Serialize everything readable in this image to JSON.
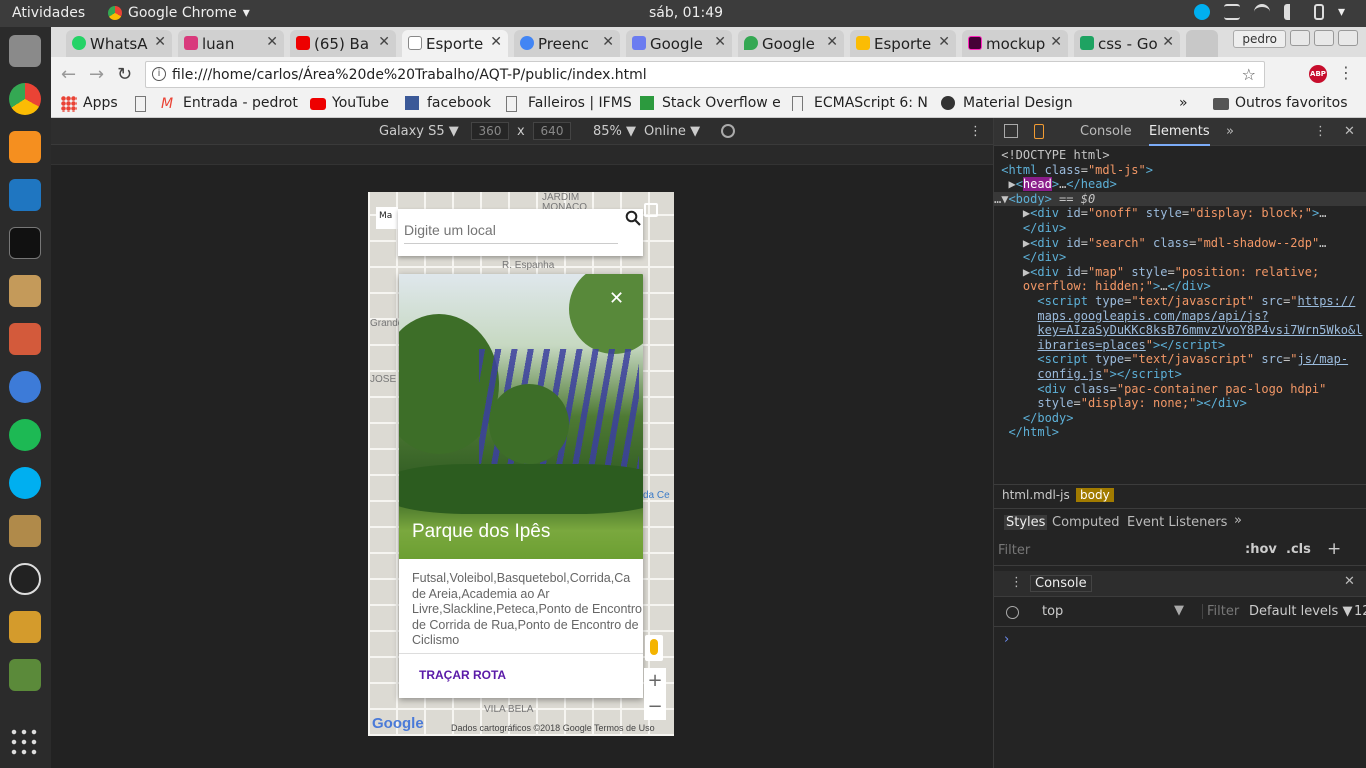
{
  "system": {
    "activities": "Atividades",
    "app_menu": "Google Chrome",
    "clock": "sáb, 01:49"
  },
  "tabs": [
    {
      "label": "WhatsA",
      "color": "#25d366"
    },
    {
      "label": "luan",
      "color": "#d93a7c"
    },
    {
      "label": "(65) Ba",
      "color": "#e00"
    },
    {
      "label": "Esporte",
      "color": "#999",
      "active": true
    },
    {
      "label": "Preenc",
      "color": "#4285f4"
    },
    {
      "label": "Google",
      "color": "#6b7cf0"
    },
    {
      "label": "Google",
      "color": "#34a853"
    },
    {
      "label": "Esporte",
      "color": "#fbbc04"
    },
    {
      "label": "mockup",
      "color": "#ff26be"
    },
    {
      "label": "css - Go",
      "color": "#1ea362"
    }
  ],
  "user_badge": "pedro",
  "address": {
    "url": "file:///home/carlos/Área%20de%20Trabalho/AQT-P/public/index.html",
    "abp": "ABP"
  },
  "bookmarks": [
    {
      "label": "Apps",
      "color": "#ea4335"
    },
    {
      "label": "",
      "color": "#bbb"
    },
    {
      "label": "Entrada - pedrot",
      "color": "#ea4335"
    },
    {
      "label": "YouTube",
      "color": "#e00"
    },
    {
      "label": "facebook",
      "color": "#3b5998"
    },
    {
      "label": "Falleiros | IFMS",
      "color": "#bbb"
    },
    {
      "label": "Stack Overflow e",
      "color": "#2c9a3e"
    },
    {
      "label": "ECMAScript 6: N",
      "color": "#bbb"
    },
    {
      "label": "Material Design",
      "color": "#333"
    },
    {
      "label": "»",
      "color": ""
    },
    {
      "label": "Outros favoritos",
      "color": "#555"
    }
  ],
  "device_toolbar": {
    "device": "Galaxy S5 ▼",
    "width": "360",
    "x": "x",
    "height": "640",
    "zoom": "85% ▼",
    "network": "Online ▼"
  },
  "map": {
    "search_placeholder": "Digite um local",
    "card_title": "Parque dos Ipês",
    "card_desc": "Futsal,Voleibol,Basquetebol,Corrida,Ca de Areia,Academia ao Ar Livre,Slackline,Peteca,Ponto de Encontro de Corrida de Rua,Ponto de Encontro de Ciclismo",
    "route_button": "TRAÇAR ROTA",
    "map_button": "Ma",
    "attribution": "Dados cartográficos ©2018 Google    Termos de Uso",
    "logo": "Google",
    "labels": [
      "JARDIM",
      "MONACO",
      "R. Espanha",
      "da Ce",
      "VILA BELA",
      "JOSE",
      "Grande"
    ]
  },
  "devtools": {
    "tabs": [
      "Console",
      "Elements",
      "»"
    ],
    "crumbs": [
      "html.mdl-js",
      "body"
    ],
    "subtabs": [
      "Styles",
      "Computed",
      "Event Listeners",
      "»"
    ],
    "filter": "Filter",
    "hov": ":hov",
    "cls": ".cls",
    "drawer": "Console",
    "context": "top",
    "filter2": "Filter",
    "levels": "Default levels ▼",
    "count": "12",
    "prompt": "›"
  }
}
